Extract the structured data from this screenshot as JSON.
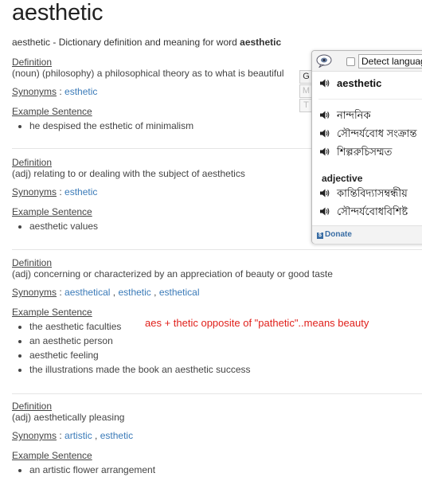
{
  "page": {
    "title": "aesthetic",
    "subtitle_prefix": "aesthetic - Dictionary definition and meaning for word ",
    "subtitle_word": "aesthetic"
  },
  "labels": {
    "definition": "Definition",
    "synonyms": "Synonyms",
    "synonyms_sep": " : ",
    "example_sentence": "Example Sentence"
  },
  "entries": [
    {
      "definition": "(noun) (philosophy) a philosophical theory as to what is beautiful",
      "synonyms": [
        "esthetic"
      ],
      "examples": [
        "he despised the esthetic of minimalism"
      ]
    },
    {
      "definition": "(adj) relating to or dealing with the subject of aesthetics",
      "synonyms": [
        "esthetic"
      ],
      "examples": [
        "aesthetic values"
      ]
    },
    {
      "definition": "(adj) concerning or characterized by an appreciation of beauty or good taste",
      "synonyms": [
        "aesthetical",
        "esthetic",
        "esthetical"
      ],
      "synonym_separator": " , ",
      "examples": [
        "the aesthetic faculties",
        "an aesthetic person",
        "aesthetic feeling",
        "the illustrations made the book an aesthetic success"
      ]
    },
    {
      "definition": "(adj) aesthetically pleasing",
      "synonyms": [
        "artistic",
        "esthetic"
      ],
      "synonym_separator": " , ",
      "examples": [
        "an artistic flower arrangement"
      ]
    }
  ],
  "annotation": {
    "text": "aes + thetic opposite of \"pathetic\"..means beauty",
    "color": "#e0201b"
  },
  "popup": {
    "select_value": "Detect language",
    "gmt": [
      "G",
      "M",
      "T"
    ],
    "word": "aesthetic",
    "translations": [
      "নান্দনিক",
      "সৌন্দর্যবোধ সংক্রান্ত",
      "শিল্পরুচিসম্মত"
    ],
    "pos_heading": "adjective",
    "adj_translations": [
      "কান্তিবিদ্যাসম্বন্ধীয়",
      "সৌন্দর্যবোধবিশিষ্ট"
    ],
    "donate_label": "Donate",
    "icons": [
      "speech-bubble-icon",
      "speaker-icon",
      "donate-icon"
    ]
  },
  "colors": {
    "link": "#3a7ab8",
    "text": "#444444"
  }
}
